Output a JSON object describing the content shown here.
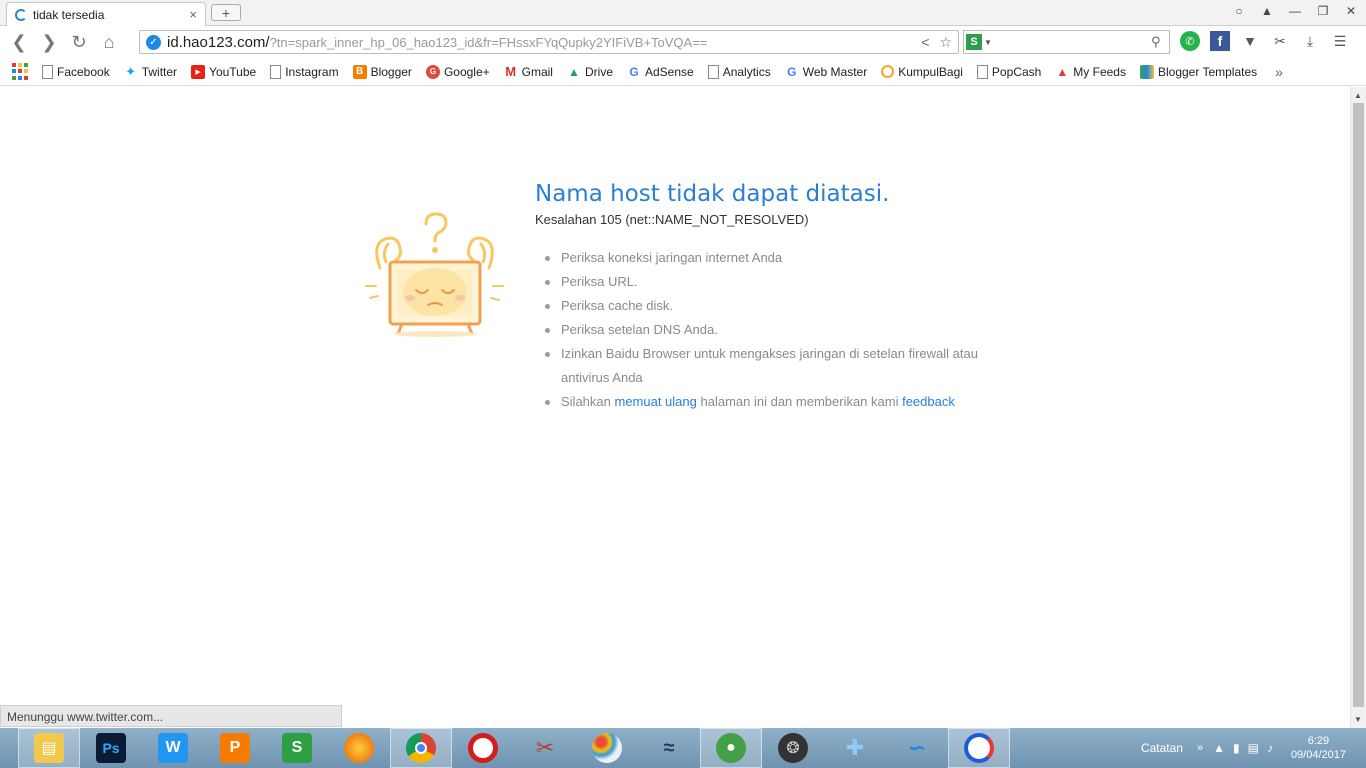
{
  "tab": {
    "title": "tidak tersedia",
    "close": "×"
  },
  "newtab": "+",
  "address": {
    "host": "id.hao123.com/",
    "path": "?tn=spark_inner_hp_06_hao123_id&fr=FHssxFYqQupky2YIFiVB+ToVQA=="
  },
  "bookmarks": [
    {
      "label": "Facebook",
      "icon": "page-icon"
    },
    {
      "label": "Twitter",
      "icon": "twitter-icon"
    },
    {
      "label": "YouTube",
      "icon": "youtube-icon"
    },
    {
      "label": "Instagram",
      "icon": "page-icon"
    },
    {
      "label": "Blogger",
      "icon": "blogger-icon"
    },
    {
      "label": "Google+",
      "icon": "googleplus-icon"
    },
    {
      "label": "Gmail",
      "icon": "gmail-icon"
    },
    {
      "label": "Drive",
      "icon": "drive-icon"
    },
    {
      "label": "AdSense",
      "icon": "google-icon"
    },
    {
      "label": "Analytics",
      "icon": "page-icon"
    },
    {
      "label": "Web Master",
      "icon": "google-icon"
    },
    {
      "label": "KumpulBagi",
      "icon": "kumpulbagi-icon"
    },
    {
      "label": "PopCash",
      "icon": "page-icon"
    },
    {
      "label": "My Feeds",
      "icon": "feeds-icon"
    },
    {
      "label": "Blogger Templates",
      "icon": "templates-icon"
    }
  ],
  "error": {
    "title": "Nama host tidak dapat diatasi.",
    "code": "Kesalahan 105 (net::NAME_NOT_RESOLVED)",
    "items": [
      "Periksa koneksi jaringan internet Anda",
      "Periksa URL.",
      "Periksa cache disk.",
      "Periksa setelan DNS Anda.",
      "Izinkan Baidu Browser untuk mengakses jaringan di setelan firewall atau antivirus Anda"
    ],
    "last_item": {
      "before": "Silahkan ",
      "link1": "memuat ulang",
      "middle": " halaman ini dan memberikan kami ",
      "link2": "feedback"
    }
  },
  "status": "Menunggu www.twitter.com...",
  "taskbar": {
    "apps": [
      "file-explorer",
      "photoshop",
      "wps-writer",
      "wps-presentation",
      "wps-spreadsheets",
      "firefox",
      "chrome",
      "opera",
      "snipping-tool",
      "paint",
      "network-app",
      "camtasia",
      "media-player",
      "game-controller",
      "dolphin",
      "baidu-browser"
    ],
    "photoshop_label": "Ps",
    "writer_label": "W",
    "presentation_label": "P",
    "spreadsheet_label": "S",
    "tray_label": "Catatan",
    "time": "6:29",
    "date": "09/04/2017"
  },
  "colors": {
    "accent": "#2a7fd5",
    "taskbar": "#7f9fba"
  }
}
